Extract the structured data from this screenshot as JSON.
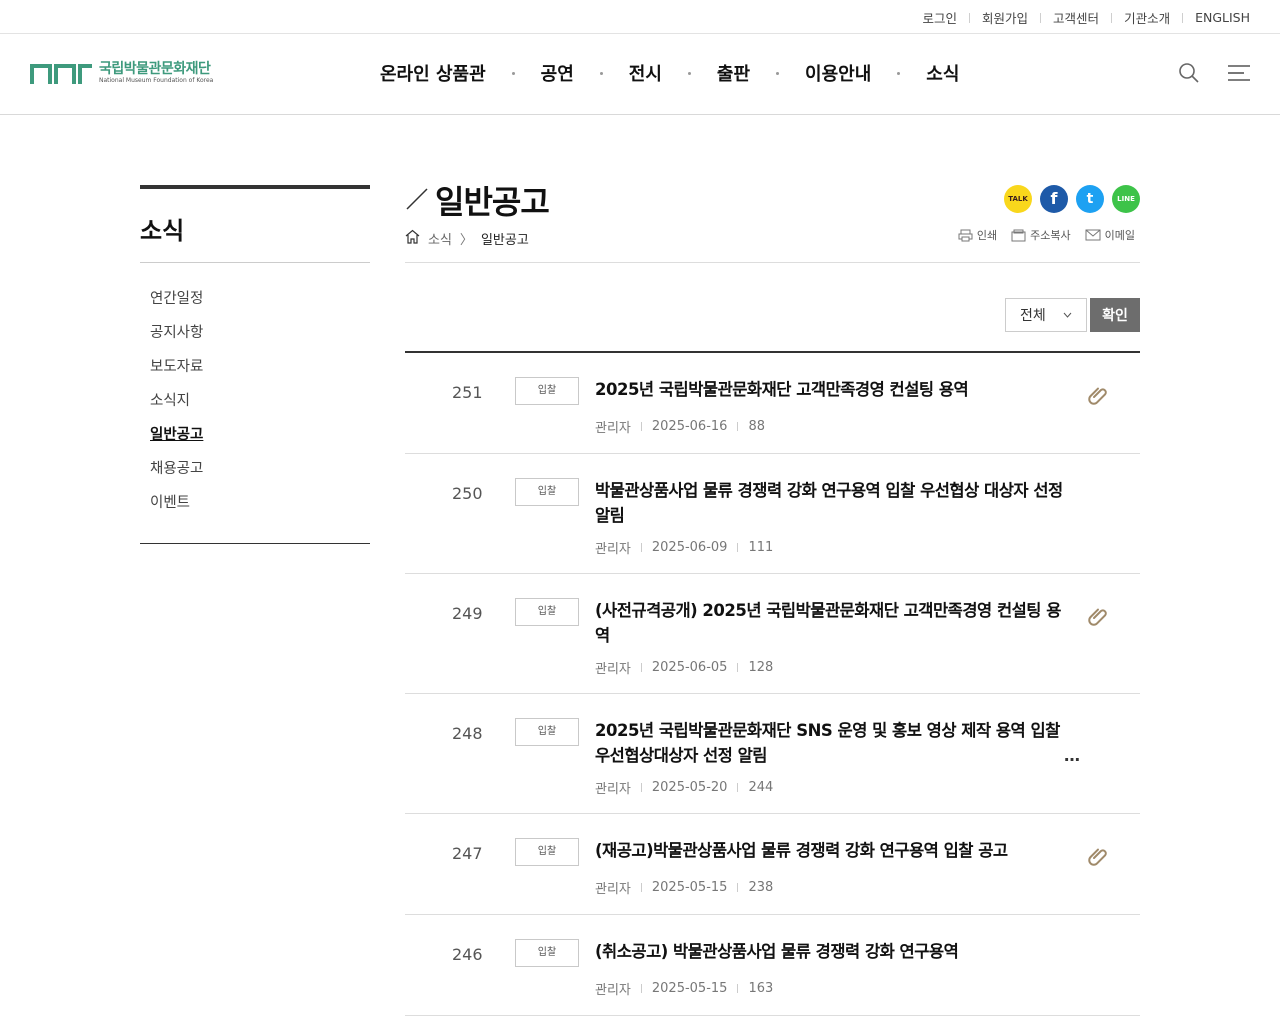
{
  "util_links": [
    "로그인",
    "회원가입",
    "고객센터",
    "기관소개",
    "ENGLISH"
  ],
  "logo": {
    "ko": "국립박물관문화재단",
    "en": "National Museum Foundation of Korea",
    "mark": "NMF"
  },
  "gnb": [
    "온라인 상품관",
    "공연",
    "전시",
    "출판",
    "이용안내",
    "소식"
  ],
  "header_icons": [
    "search-icon",
    "menu-icon"
  ],
  "sidebar": {
    "title": "소식",
    "items": [
      {
        "label": "연간일정",
        "active": false
      },
      {
        "label": "공지사항",
        "active": false
      },
      {
        "label": "보도자료",
        "active": false
      },
      {
        "label": "소식지",
        "active": false
      },
      {
        "label": "일반공고",
        "active": true
      },
      {
        "label": "채용공고",
        "active": false
      },
      {
        "label": "이벤트",
        "active": false
      }
    ]
  },
  "page": {
    "title": "일반공고",
    "breadcrumb": [
      "소식",
      "일반공고"
    ]
  },
  "share": [
    {
      "name": "kakaotalk",
      "label": "TALK",
      "color": "#f9d71c"
    },
    {
      "name": "facebook",
      "label": "f",
      "color": "#1e5aa8"
    },
    {
      "name": "twitter",
      "label": "t",
      "color": "#1da1f2"
    },
    {
      "name": "line",
      "label": "LINE",
      "color": "#3dc349"
    }
  ],
  "tools": {
    "print": "인쇄",
    "copy_url": "주소복사",
    "email": "이메일"
  },
  "filter": {
    "selected": "전체",
    "confirm": "확인"
  },
  "posts": [
    {
      "num": "251",
      "category": "입찰",
      "title": "2025년 국립박물관문화재단 고객만족경영 컨설팅 용역",
      "author": "관리자",
      "date": "2025-06-16",
      "views": "88",
      "attachment": true,
      "lines": 1,
      "truncated": false
    },
    {
      "num": "250",
      "category": "입찰",
      "title": "박물관상품사업 물류 경쟁력 강화 연구용역 입찰 우선협상 대상자 선정 알림",
      "author": "관리자",
      "date": "2025-06-09",
      "views": "111",
      "attachment": false,
      "lines": 2,
      "truncated": false
    },
    {
      "num": "249",
      "category": "입찰",
      "title": "(사전규격공개) 2025년 국립박물관문화재단 고객만족경영 컨설팅 용역",
      "author": "관리자",
      "date": "2025-06-05",
      "views": "128",
      "attachment": true,
      "lines": 2,
      "truncated": false
    },
    {
      "num": "248",
      "category": "입찰",
      "title": "2025년 국립박물관문화재단 SNS 운영 및 홍보 영상 제작 용역 입찰 우선협상대상자 선정 알림",
      "author": "관리자",
      "date": "2025-05-20",
      "views": "244",
      "attachment": false,
      "lines": 2,
      "truncated": true
    },
    {
      "num": "247",
      "category": "입찰",
      "title": "(재공고)박물관상품사업 물류 경쟁력 강화 연구용역 입찰 공고",
      "author": "관리자",
      "date": "2025-05-15",
      "views": "238",
      "attachment": true,
      "lines": 1,
      "truncated": false
    },
    {
      "num": "246",
      "category": "입찰",
      "title": "(취소공고) 박물관상품사업 물류 경쟁력 강화 연구용역",
      "author": "관리자",
      "date": "2025-05-15",
      "views": "163",
      "attachment": false,
      "lines": 1,
      "truncated": false
    }
  ],
  "more_glyph": "…"
}
